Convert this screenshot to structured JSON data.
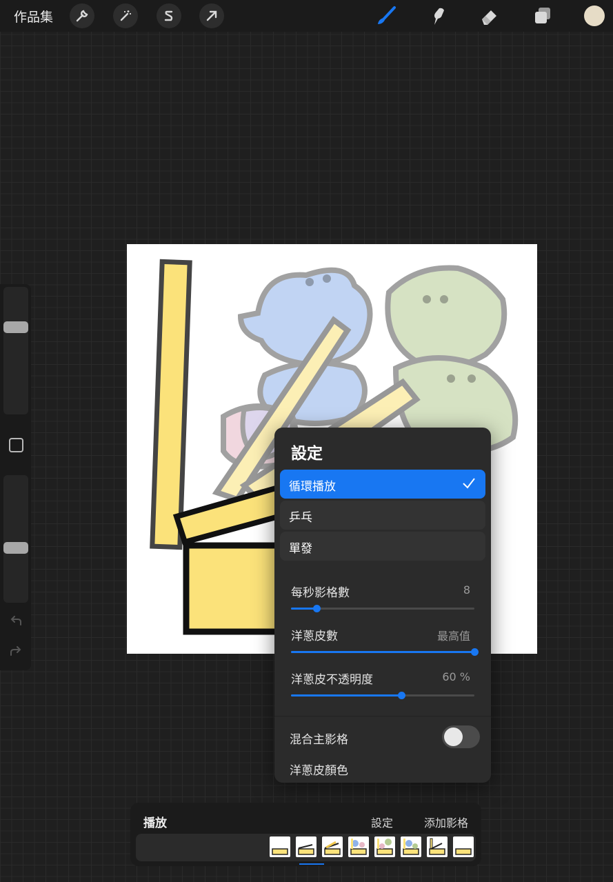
{
  "topbar": {
    "gallery_label": "作品集",
    "left_tools": [
      "wrench-icon",
      "magic-wand-icon",
      "selection-s-icon",
      "arrow-icon"
    ],
    "right_tools": [
      "brush-icon",
      "smudge-icon",
      "eraser-icon",
      "layers-icon"
    ],
    "active_tool": "brush-icon",
    "current_color": "#e6dcc6",
    "accent": "#1877f2"
  },
  "sidebar": {
    "brush_size_level": 0.7,
    "opacity_level": 0.42,
    "icons": [
      "modify-square-icon",
      "undo-icon",
      "redo-icon"
    ]
  },
  "settings_popup": {
    "title": "設定",
    "playback_modes": [
      {
        "label": "循環播放",
        "selected": true
      },
      {
        "label": "乒乓",
        "selected": false
      },
      {
        "label": "單發",
        "selected": false
      }
    ],
    "frames_per_second": {
      "label": "每秒影格數",
      "value": "8",
      "level": 0.14
    },
    "onion_skin_frames": {
      "label": "洋蔥皮數",
      "value": "最高值",
      "level": 1.0
    },
    "onion_skin_opacity": {
      "label": "洋蔥皮不透明度",
      "value": "60 %",
      "level": 0.6
    },
    "blend_primary": {
      "label": "混合主影格",
      "on": false
    },
    "onion_skin_colors": {
      "label": "洋蔥皮顏色"
    }
  },
  "animation_panel": {
    "title": "播放",
    "settings_label": "設定",
    "add_frame_label": "添加影格",
    "frame_count": 8,
    "current_frame_index": 1
  }
}
